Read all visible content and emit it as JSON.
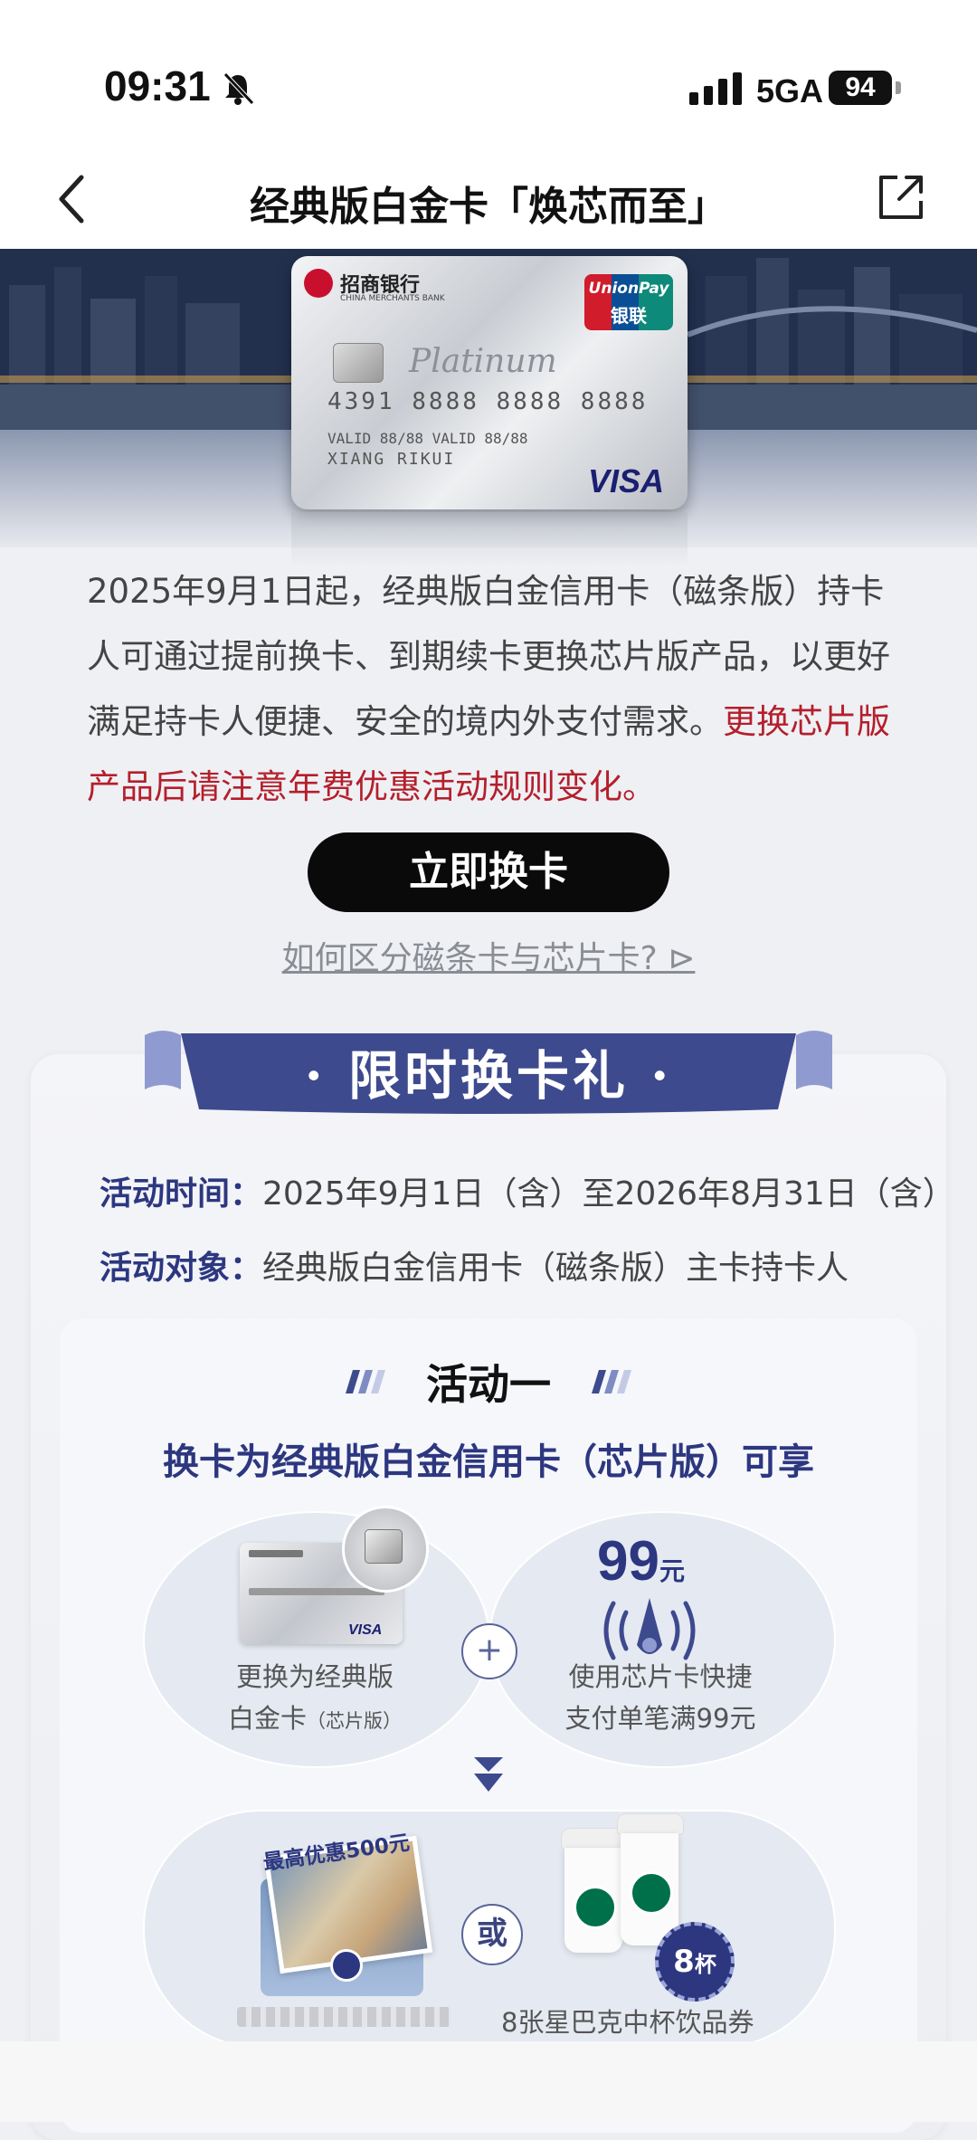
{
  "status_bar": {
    "time": "09:31",
    "network": "5GA",
    "battery": "94"
  },
  "nav": {
    "title": "经典版白金卡「焕芯而至」"
  },
  "card": {
    "bank_name": "招商银行",
    "bank_name_en": "CHINA MERCHANTS BANK",
    "unionpay_en": "UnionPay",
    "unionpay_cn": "银联",
    "product": "Platinum",
    "number": "4391 8888 8888 8888",
    "valid": "VALID 88/88  VALID 88/88",
    "holder": "XIANG RIKUI",
    "network": "VISA"
  },
  "intro": {
    "text": "2025年9月1日起，经典版白金信用卡（磁条版）持卡人可通过提前换卡、到期续卡更换芯片版产品，以更好满足持卡人便捷、安全的境内外支付需求。",
    "highlight": "更换芯片版产品后请注意年费优惠活动规则变化。"
  },
  "cta": {
    "label": "立即换卡"
  },
  "how_link": {
    "label": "如何区分磁条卡与芯片卡? ⊳"
  },
  "promo": {
    "title": "· 限时换卡礼 ·",
    "time_label": "活动时间：",
    "time_value": "2025年9月1日（含）至2026年8月31日（含）",
    "target_label": "活动对象：",
    "target_value": "经典版白金信用卡（磁条版）主卡持卡人"
  },
  "activity_one": {
    "title": "活动一",
    "subtitle": "换卡为经典版白金信用卡（芯片版）可享",
    "step1_line1": "更换为经典版",
    "step1_line2": "白金卡",
    "step1_note": "（芯片版）",
    "plus": "+",
    "price": "99",
    "price_unit": "元",
    "step2_line1": "使用芯片卡快捷",
    "step2_line2": "支付单笔满99元",
    "coupon_tag": "最高优惠500元",
    "or": "或",
    "cups_badge": "8",
    "cups_badge_unit": "杯",
    "starbucks_label": "8张星巴克中杯饮品券"
  },
  "colors": {
    "brand_navy": "#2d3780",
    "warning_red": "#b41f2b",
    "cta_black": "#0a0a0a"
  }
}
